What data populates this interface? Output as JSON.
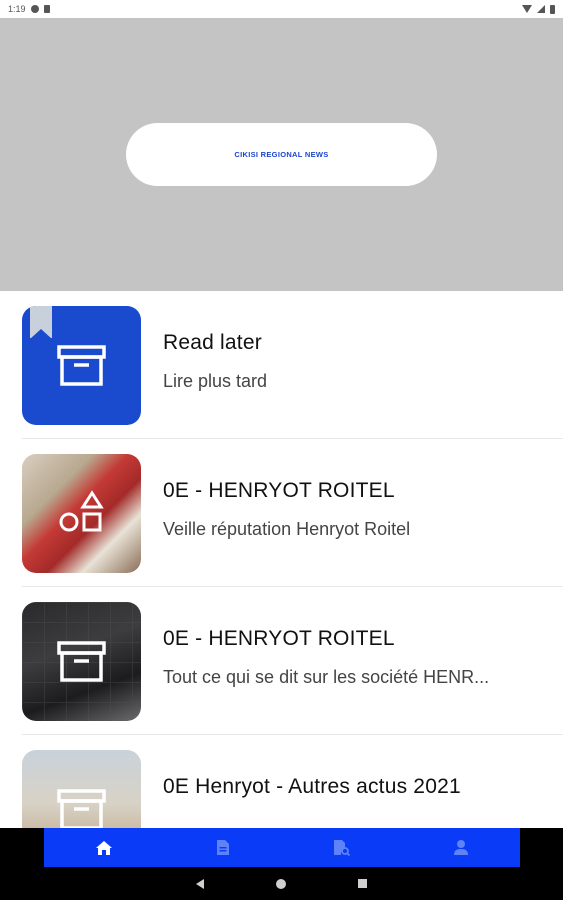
{
  "status_bar": {
    "time": "1:19"
  },
  "banner": {
    "pill_text": "CIKISI REGIONAL NEWS"
  },
  "items": [
    {
      "title": "Read later",
      "subtitle": "Lire plus tard",
      "icon": "archive-box-icon"
    },
    {
      "title": "0E - HENRYOT ROITEL",
      "subtitle": "Veille réputation Henryot Roitel",
      "icon": "shapes-icon"
    },
    {
      "title": "0E - HENRYOT ROITEL",
      "subtitle": "Tout ce qui se dit sur les société HENR...",
      "icon": "archive-box-icon"
    },
    {
      "title": "0E Henryot - Autres actus 2021",
      "subtitle": "",
      "icon": "archive-box-icon"
    }
  ],
  "tabs": [
    {
      "name": "home-icon",
      "active": true
    },
    {
      "name": "document-icon",
      "active": false
    },
    {
      "name": "search-document-icon",
      "active": false
    },
    {
      "name": "profile-icon",
      "active": false
    }
  ],
  "colors": {
    "accent": "#0a3cf7",
    "brand_blue": "#1a4bcf",
    "banner_gray": "#c4c4c4"
  }
}
